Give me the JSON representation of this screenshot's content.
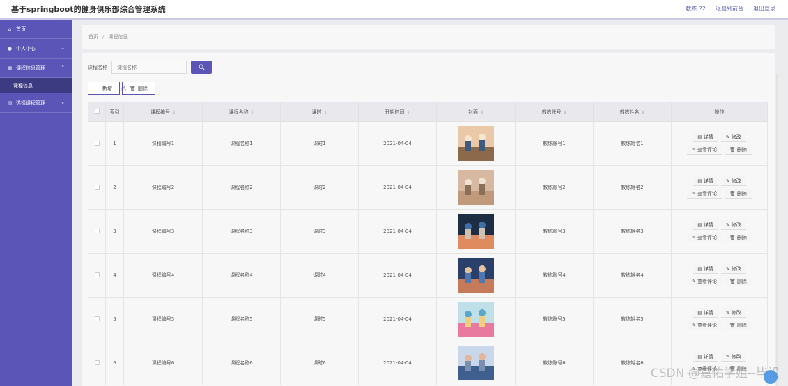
{
  "app": {
    "title": "基于springboot的健身俱乐部综合管理系统"
  },
  "topbar": {
    "user": "教练 22",
    "exit_to_frontend": "退出到前台",
    "logout": "退出登录"
  },
  "sidebar": {
    "items": [
      {
        "label": "首页",
        "icon": "home-icon"
      },
      {
        "label": "个人中心",
        "icon": "user-icon",
        "chevron": "⌄"
      },
      {
        "label": "课程信息管理",
        "icon": "grid-icon",
        "chevron": "⌃"
      },
      {
        "label": "选择课程管理",
        "icon": "calendar-icon",
        "chevron": "⌄"
      }
    ],
    "sub_active": "课程信息"
  },
  "breadcrumb": {
    "home": "首页",
    "sep": "/",
    "current": "课程信息"
  },
  "search": {
    "label": "课程名称",
    "placeholder": "课程名称"
  },
  "actions": {
    "add": "新增",
    "delete": "删除"
  },
  "table": {
    "headers": [
      "索引",
      "课程编号",
      "课程名称",
      "课时",
      "开始时间",
      "封面",
      "教练账号",
      "教练姓名",
      "操作"
    ],
    "op_labels": {
      "detail": "详情",
      "edit": "修改",
      "comments": "查看评论",
      "delete": "删除"
    },
    "rows": [
      {
        "index": "1",
        "code": "课程编号1",
        "name": "课程名称1",
        "hours": "课时1",
        "start": "2021-04-04",
        "account": "教练账号1",
        "coach": "教练姓名1"
      },
      {
        "index": "2",
        "code": "课程编号2",
        "name": "课程名称2",
        "hours": "课时2",
        "start": "2021-04-04",
        "account": "教练账号2",
        "coach": "教练姓名2"
      },
      {
        "index": "3",
        "code": "课程编号3",
        "name": "课程名称3",
        "hours": "课时3",
        "start": "2021-04-04",
        "account": "教练账号3",
        "coach": "教练姓名3"
      },
      {
        "index": "4",
        "code": "课程编号4",
        "name": "课程名称4",
        "hours": "课时4",
        "start": "2021-04-04",
        "account": "教练账号4",
        "coach": "教练姓名4"
      },
      {
        "index": "5",
        "code": "课程编号5",
        "name": "课程名称5",
        "hours": "课时5",
        "start": "2021-04-04",
        "account": "教练账号5",
        "coach": "教练姓名5"
      },
      {
        "index": "6",
        "code": "课程编号6",
        "name": "课程名称6",
        "hours": "课时6",
        "start": "2021-04-04",
        "account": "教练账号6",
        "coach": "教练姓名6"
      }
    ]
  },
  "watermark": "CSDN @嘉佑学姐--毕设",
  "colors": {
    "accent": "#5a55b6",
    "sidebar_active": "#3c3a80"
  }
}
